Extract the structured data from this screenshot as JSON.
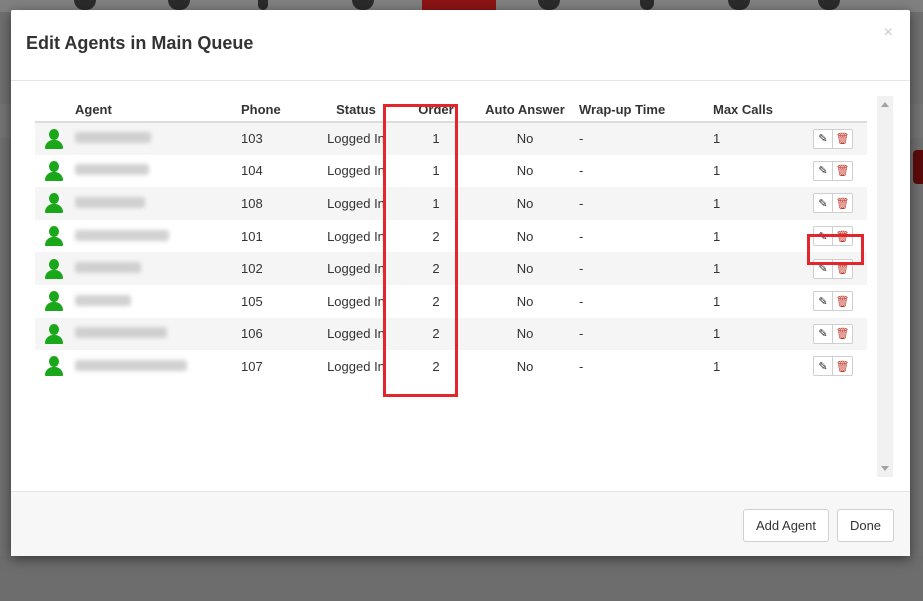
{
  "modal": {
    "title": "Edit Agents in Main Queue",
    "close_label": "×"
  },
  "table": {
    "headers": {
      "agent": "Agent",
      "phone": "Phone",
      "status": "Status",
      "order": "Order",
      "auto_answer": "Auto Answer",
      "wrap_up": "Wrap-up Time",
      "max_calls": "Max Calls"
    },
    "rows": [
      {
        "phone": "103",
        "status": "Logged In",
        "order": "1",
        "auto_answer": "No",
        "wrap_up": "-",
        "max_calls": "1"
      },
      {
        "phone": "104",
        "status": "Logged In",
        "order": "1",
        "auto_answer": "No",
        "wrap_up": "-",
        "max_calls": "1"
      },
      {
        "phone": "108",
        "status": "Logged In",
        "order": "1",
        "auto_answer": "No",
        "wrap_up": "-",
        "max_calls": "1"
      },
      {
        "phone": "101",
        "status": "Logged In",
        "order": "2",
        "auto_answer": "No",
        "wrap_up": "-",
        "max_calls": "1"
      },
      {
        "phone": "102",
        "status": "Logged In",
        "order": "2",
        "auto_answer": "No",
        "wrap_up": "-",
        "max_calls": "1"
      },
      {
        "phone": "105",
        "status": "Logged In",
        "order": "2",
        "auto_answer": "No",
        "wrap_up": "-",
        "max_calls": "1"
      },
      {
        "phone": "106",
        "status": "Logged In",
        "order": "2",
        "auto_answer": "No",
        "wrap_up": "-",
        "max_calls": "1"
      },
      {
        "phone": "107",
        "status": "Logged In",
        "order": "2",
        "auto_answer": "No",
        "wrap_up": "-",
        "max_calls": "1"
      }
    ]
  },
  "icons": {
    "avatar": "user-icon",
    "edit": "pencil-icon",
    "delete": "trash-icon"
  },
  "footer": {
    "add_agent_label": "Add Agent",
    "done_label": "Done"
  },
  "colors": {
    "agent_online": "#1aa81a",
    "highlight": "#e3262b",
    "delete_icon": "#c0392b"
  }
}
